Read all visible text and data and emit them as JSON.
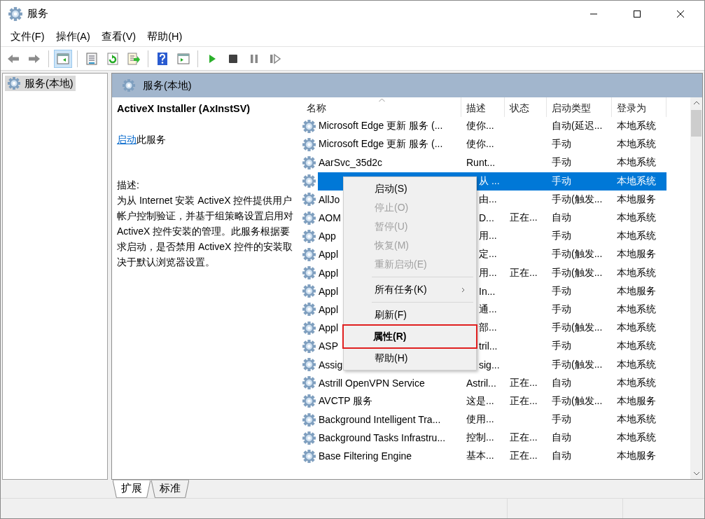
{
  "window": {
    "title": "服务"
  },
  "menu": [
    "文件(F)",
    "操作(A)",
    "查看(V)",
    "帮助(H)"
  ],
  "toolbar": [
    [
      {
        "kind": "back",
        "on": false
      },
      {
        "kind": "forward",
        "on": false
      }
    ],
    [
      {
        "kind": "tree",
        "on": true
      }
    ],
    [
      {
        "kind": "properties",
        "on": false
      },
      {
        "kind": "refresh",
        "on": false
      },
      {
        "kind": "export",
        "on": false
      }
    ],
    [
      {
        "kind": "help",
        "on": false
      },
      {
        "kind": "action",
        "on": false
      }
    ],
    [
      {
        "kind": "start",
        "on": false
      },
      {
        "kind": "stop",
        "on": false
      },
      {
        "kind": "pause",
        "on": false
      },
      {
        "kind": "resume",
        "on": false
      }
    ]
  ],
  "tree": {
    "items": [
      {
        "label": "服务(本地)",
        "selected": true
      }
    ]
  },
  "pane": {
    "header": "服务(本地)"
  },
  "details": {
    "title": "ActiveX Installer (AxInstSV)",
    "link": "启动",
    "link_suffix": "此服务",
    "description_label": "描述:",
    "description": "为从 Internet 安装 ActiveX 控件提供用户帐户控制验证，并基于组策略设置启用对 ActiveX 控件安装的管理。此服务根据要求启动，是否禁用 ActiveX 控件的安装取决于默认浏览器设置。"
  },
  "table": {
    "columns": [
      "名称",
      "描述",
      "状态",
      "启动类型",
      "登录为"
    ],
    "rows": [
      {
        "kind": "full",
        "selected": false,
        "name": "Microsoft Edge 更新 服务 (...",
        "description": "使你...",
        "startup_type": "自动(延迟...",
        "logon": "本地系统"
      },
      {
        "kind": "full",
        "selected": false,
        "name": "Microsoft Edge 更新 服务 (...",
        "description": "使你...",
        "startup_type": "手动",
        "logon": "本地系统"
      },
      {
        "kind": "full",
        "selected": false,
        "name": "AarSvc_35d2c",
        "description": "Runt...",
        "startup_type": "手动",
        "logon": "本地系统"
      },
      {
        "kind": "covered",
        "selected": true,
        "description": "从 ...",
        "startup_type": "手动",
        "logon": "本地系统"
      },
      {
        "kind": "covered",
        "selected": false,
        "name": "AllJo",
        "description": "由...",
        "startup_type": "手动(触发...",
        "logon": "本地服务"
      },
      {
        "kind": "covered",
        "selected": false,
        "name": "AOM",
        "description": "D...",
        "status": "正在...",
        "startup_type": "自动",
        "logon": "本地系统"
      },
      {
        "kind": "covered",
        "selected": false,
        "name": "App",
        "description": "用...",
        "startup_type": "手动",
        "logon": "本地系统"
      },
      {
        "kind": "covered",
        "selected": false,
        "name": "Appl",
        "description": "定...",
        "startup_type": "手动(触发...",
        "logon": "本地服务"
      },
      {
        "kind": "covered",
        "selected": false,
        "name": "Appl",
        "description": "用...",
        "status": "正在...",
        "startup_type": "手动(触发...",
        "logon": "本地系统"
      },
      {
        "kind": "covered",
        "selected": false,
        "name": "Appl",
        "description": "In...",
        "startup_type": "手动",
        "logon": "本地服务"
      },
      {
        "kind": "covered",
        "selected": false,
        "name": "Appl",
        "description": "通...",
        "startup_type": "手动",
        "logon": "本地系统"
      },
      {
        "kind": "covered",
        "selected": false,
        "name": "Appl",
        "description": "部...",
        "startup_type": "手动(触发...",
        "logon": "本地系统"
      },
      {
        "kind": "covered",
        "selected": false,
        "name": "ASP",
        "description": "tril...",
        "startup_type": "手动",
        "logon": "本地系统"
      },
      {
        "kind": "covered",
        "selected": false,
        "name": "Assig",
        "description": "sig...",
        "startup_type": "手动(触发...",
        "logon": "本地系统"
      },
      {
        "kind": "full",
        "selected": false,
        "name": "Astrill OpenVPN Service",
        "description": "Astril...",
        "status": "正在...",
        "startup_type": "自动",
        "logon": "本地系统"
      },
      {
        "kind": "full",
        "selected": false,
        "name": "AVCTP 服务",
        "description": "这是...",
        "status": "正在...",
        "startup_type": "手动(触发...",
        "logon": "本地服务"
      },
      {
        "kind": "full",
        "selected": false,
        "name": "Background Intelligent Tra...",
        "description": "使用...",
        "startup_type": "手动",
        "logon": "本地系统"
      },
      {
        "kind": "full",
        "selected": false,
        "name": "Background Tasks Infrastru...",
        "description": "控制...",
        "status": "正在...",
        "startup_type": "自动",
        "logon": "本地系统"
      },
      {
        "kind": "full",
        "selected": false,
        "name": "Base Filtering Engine",
        "description": "基本...",
        "status": "正在...",
        "startup_type": "自动",
        "logon": "本地服务"
      }
    ]
  },
  "context_menu": {
    "items": [
      {
        "kind": "item",
        "label": "启动(S)",
        "disabled": false,
        "bold": false,
        "submenu": false,
        "outlined": false
      },
      {
        "kind": "item",
        "label": "停止(O)",
        "disabled": true,
        "bold": false,
        "submenu": false,
        "outlined": false
      },
      {
        "kind": "item",
        "label": "暂停(U)",
        "disabled": true,
        "bold": false,
        "submenu": false,
        "outlined": false
      },
      {
        "kind": "item",
        "label": "恢复(M)",
        "disabled": true,
        "bold": false,
        "submenu": false,
        "outlined": false
      },
      {
        "kind": "item",
        "label": "重新启动(E)",
        "disabled": true,
        "bold": false,
        "submenu": false,
        "outlined": false
      },
      {
        "kind": "separator"
      },
      {
        "kind": "item",
        "label": "所有任务(K)",
        "disabled": false,
        "bold": false,
        "submenu": true,
        "outlined": false
      },
      {
        "kind": "separator"
      },
      {
        "kind": "item",
        "label": "刷新(F)",
        "disabled": false,
        "bold": false,
        "submenu": false,
        "outlined": false
      },
      {
        "kind": "item",
        "label": "属性(R)",
        "disabled": false,
        "bold": true,
        "submenu": false,
        "outlined": true
      },
      {
        "kind": "item",
        "label": "帮助(H)",
        "disabled": false,
        "bold": false,
        "submenu": false,
        "outlined": false
      }
    ]
  },
  "tabs": [
    {
      "label": "扩展",
      "selected": true
    },
    {
      "label": "标准",
      "selected": false
    }
  ]
}
